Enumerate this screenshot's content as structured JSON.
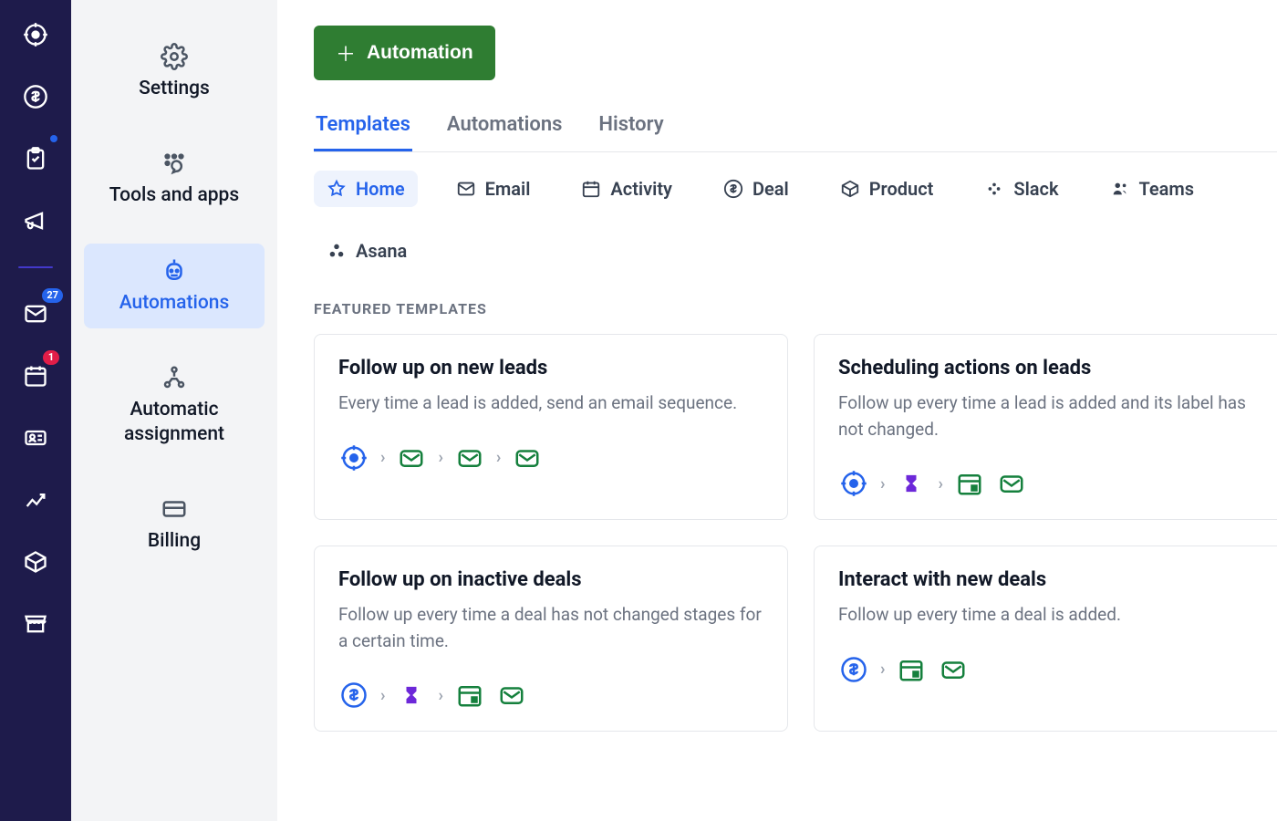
{
  "rail": {
    "items": [
      {
        "name": "leads-icon",
        "badge": null,
        "dot": false
      },
      {
        "name": "deals-icon",
        "badge": null,
        "dot": false
      },
      {
        "name": "projects-icon",
        "badge": null,
        "dot": true
      },
      {
        "name": "campaigns-icon",
        "badge": null,
        "dot": false
      }
    ],
    "items2": [
      {
        "name": "mail-icon",
        "badge": "27",
        "badgeColor": "blue"
      },
      {
        "name": "activities-icon",
        "badge": "1",
        "badgeColor": "red"
      },
      {
        "name": "contacts-icon",
        "badge": null
      },
      {
        "name": "insights-icon",
        "badge": null
      },
      {
        "name": "products-icon",
        "badge": null
      },
      {
        "name": "marketplace-icon",
        "badge": null
      }
    ]
  },
  "sidepanel": {
    "items": [
      {
        "label": "Settings",
        "icon": "gear-icon",
        "active": false
      },
      {
        "label": "Tools and apps",
        "icon": "apps-icon",
        "active": false
      },
      {
        "label": "Automations",
        "icon": "robot-icon",
        "active": true
      },
      {
        "label": "Automatic assignment",
        "icon": "assignment-icon",
        "active": false
      },
      {
        "label": "Billing",
        "icon": "card-icon",
        "active": false
      }
    ]
  },
  "main": {
    "add_button": "Automation",
    "tabs": [
      {
        "label": "Templates",
        "active": true
      },
      {
        "label": "Automations",
        "active": false
      },
      {
        "label": "History",
        "active": false
      }
    ],
    "filters": [
      {
        "label": "Home",
        "icon": "star-icon",
        "active": true
      },
      {
        "label": "Email",
        "icon": "mail-small-icon",
        "active": false
      },
      {
        "label": "Activity",
        "icon": "calendar-small-icon",
        "active": false
      },
      {
        "label": "Deal",
        "icon": "dollar-small-icon",
        "active": false
      },
      {
        "label": "Product",
        "icon": "cube-icon",
        "active": false
      },
      {
        "label": "Slack",
        "icon": "slack-icon",
        "active": false
      },
      {
        "label": "Teams",
        "icon": "teams-icon",
        "active": false
      },
      {
        "label": "Asana",
        "icon": "asana-icon",
        "active": false
      }
    ],
    "section_title": "FEATURED TEMPLATES",
    "cards": [
      {
        "title": "Follow up on new leads",
        "desc": "Every time a lead is added, send an email sequence.",
        "steps": [
          "target",
          "mail",
          "mail",
          "mail"
        ]
      },
      {
        "title": "Scheduling actions on leads",
        "desc": "Follow up every time a lead is added and its label has not changed.",
        "steps": [
          "target",
          "hourglass",
          "calendar+mail"
        ]
      },
      {
        "title": "Follow up on inactive deals",
        "desc": "Follow up every time a deal has not changed stages for a certain time.",
        "steps": [
          "dollar",
          "hourglass",
          "calendar+mail"
        ]
      },
      {
        "title": "Interact with new deals",
        "desc": "Follow up every time a deal is added.",
        "steps": [
          "dollar",
          "calendar+mail"
        ]
      }
    ]
  }
}
